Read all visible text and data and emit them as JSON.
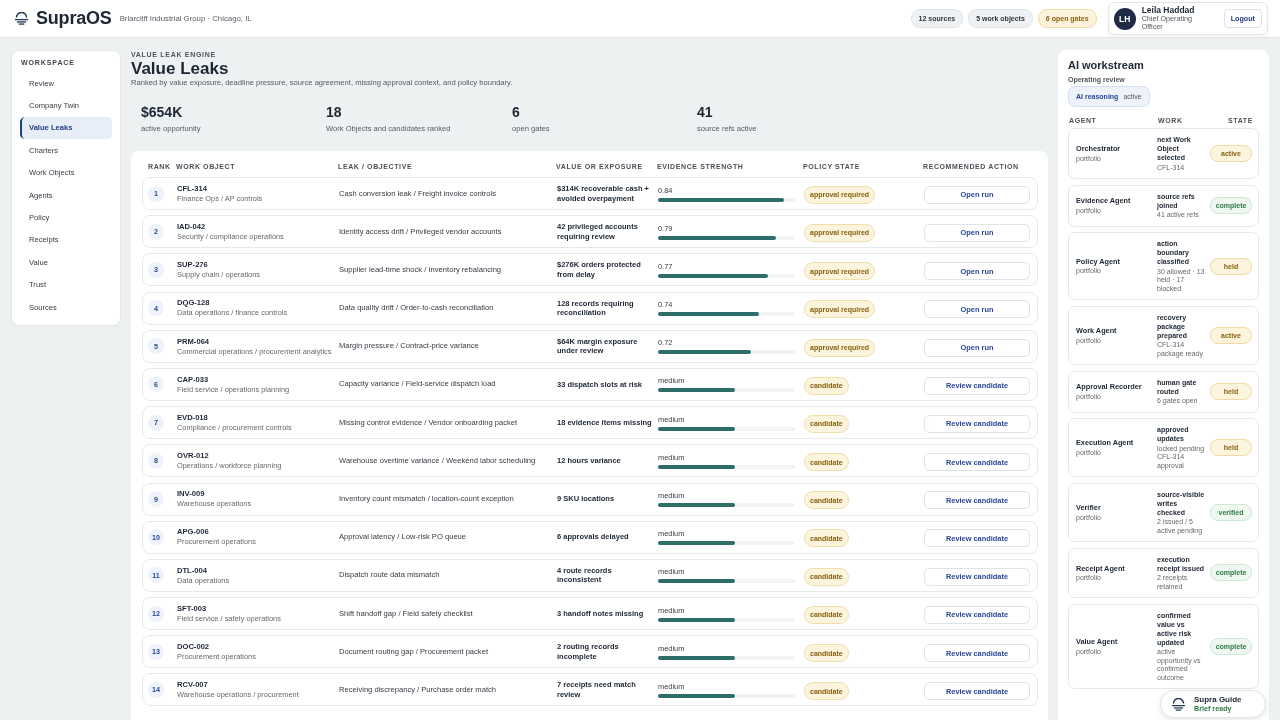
{
  "top_bar": {
    "brand": "SupraOS",
    "organization": "Briarcliff Industrial Group · Chicago, IL",
    "chips": [
      {
        "label": "12 sources",
        "kind": "neutral"
      },
      {
        "label": "5 work objects",
        "kind": "neutral"
      },
      {
        "label": "6 open gates",
        "kind": "warning"
      }
    ],
    "user": {
      "initials": "LH",
      "name": "Leila Haddad",
      "role": "Chief Operating Officer"
    },
    "logout": "Logout"
  },
  "sidebar": {
    "heading": "WORKSPACE",
    "items": [
      {
        "label": "Review",
        "selected": false
      },
      {
        "label": "Company Twin",
        "selected": false
      },
      {
        "label": "Value Leaks",
        "selected": true
      },
      {
        "label": "Charters",
        "selected": false
      },
      {
        "label": "Work Objects",
        "selected": false
      },
      {
        "label": "Agents",
        "selected": false
      },
      {
        "label": "Policy",
        "selected": false
      },
      {
        "label": "Receipts",
        "selected": false
      },
      {
        "label": "Value",
        "selected": false
      },
      {
        "label": "Trust",
        "selected": false
      },
      {
        "label": "Sources",
        "selected": false
      }
    ]
  },
  "page": {
    "kicker": "VALUE LEAK ENGINE",
    "title": "Value Leaks",
    "description": "Ranked by value exposure, deadline pressure, source agreement, missing approval context, and policy boundary."
  },
  "stats": [
    {
      "value": "$654K",
      "label": "active opportunity"
    },
    {
      "value": "18",
      "label": "Work Objects and candidates ranked"
    },
    {
      "value": "6",
      "label": "open gates"
    },
    {
      "value": "41",
      "label": "source refs active"
    }
  ],
  "table": {
    "columns": [
      "RANK",
      "WORK OBJECT",
      "LEAK / OBJECTIVE",
      "VALUE OR EXPOSURE",
      "EVIDENCE STRENGTH",
      "POLICY STATE",
      "RECOMMENDED ACTION"
    ],
    "rows": [
      {
        "rank": "1",
        "code": "CFL-314",
        "area": "Finance Ops / AP controls",
        "objective": "Cash conversion leak / Freight invoice controls",
        "value": "$314K recoverable cash + avoided overpayment",
        "evidence": "0.84",
        "level": 0.92,
        "policy": "approval required",
        "action": "Open run"
      },
      {
        "rank": "2",
        "code": "IAD-042",
        "area": "Security / compliance operations",
        "objective": "Identity access drift / Privileged vendor accounts",
        "value": "42 privileged accounts requiring review",
        "evidence": "0.79",
        "level": 0.86,
        "policy": "approval required",
        "action": "Open run"
      },
      {
        "rank": "3",
        "code": "SUP-276",
        "area": "Supply chain / operations",
        "objective": "Supplier lead-time shock / Inventory rebalancing",
        "value": "$276K orders protected from delay",
        "evidence": "0.77",
        "level": 0.8,
        "policy": "approval required",
        "action": "Open run"
      },
      {
        "rank": "4",
        "code": "DQG-128",
        "area": "Data operations / finance controls",
        "objective": "Data quality drift / Order-to-cash reconciliation",
        "value": "128 records requiring reconciliation",
        "evidence": "0.74",
        "level": 0.74,
        "policy": "approval required",
        "action": "Open run"
      },
      {
        "rank": "5",
        "code": "PRM-064",
        "area": "Commercial operations / procurement analytics",
        "objective": "Margin pressure / Contract-price variance",
        "value": "$64K margin exposure under review",
        "evidence": "0.72",
        "level": 0.68,
        "policy": "approval required",
        "action": "Open run"
      },
      {
        "rank": "6",
        "code": "CAP-033",
        "area": "Field service / operations planning",
        "objective": "Capacity variance / Field-service dispatch load",
        "value": "33 dispatch slots at risk",
        "evidence": "medium",
        "level": 0.56,
        "policy": "candidate",
        "action": "Review candidate"
      },
      {
        "rank": "7",
        "code": "EVD-018",
        "area": "Compliance / procurement controls",
        "objective": "Missing control evidence / Vendor onboarding packet",
        "value": "18 evidence items missing",
        "evidence": "medium",
        "level": 0.56,
        "policy": "candidate",
        "action": "Review candidate"
      },
      {
        "rank": "8",
        "code": "OVR-012",
        "area": "Operations / workforce planning",
        "objective": "Warehouse overtime variance / Weekend labor scheduling",
        "value": "12 hours variance",
        "evidence": "medium",
        "level": 0.56,
        "policy": "candidate",
        "action": "Review candidate"
      },
      {
        "rank": "9",
        "code": "INV-009",
        "area": "Warehouse operations",
        "objective": "Inventory count mismatch / location-count exception",
        "value": "9 SKU locations",
        "evidence": "medium",
        "level": 0.56,
        "policy": "candidate",
        "action": "Review candidate"
      },
      {
        "rank": "10",
        "code": "APG-006",
        "area": "Procurement operations",
        "objective": "Approval latency / Low-risk PO queue",
        "value": "6 approvals delayed",
        "evidence": "medium",
        "level": 0.56,
        "policy": "candidate",
        "action": "Review candidate"
      },
      {
        "rank": "11",
        "code": "DTL-004",
        "area": "Data operations",
        "objective": "Dispatch route data mismatch",
        "value": "4 route records inconsistent",
        "evidence": "medium",
        "level": 0.56,
        "policy": "candidate",
        "action": "Review candidate"
      },
      {
        "rank": "12",
        "code": "SFT-003",
        "area": "Field service / safety operations",
        "objective": "Shift handoff gap / Field safety checklist",
        "value": "3 handoff notes missing",
        "evidence": "medium",
        "level": 0.56,
        "policy": "candidate",
        "action": "Review candidate"
      },
      {
        "rank": "13",
        "code": "DOC-002",
        "area": "Procurement operations",
        "objective": "Document routing gap / Procurement packet",
        "value": "2 routing records incomplete",
        "evidence": "medium",
        "level": 0.56,
        "policy": "candidate",
        "action": "Review candidate"
      },
      {
        "rank": "14",
        "code": "RCV-007",
        "area": "Warehouse operations / procurement",
        "objective": "Receiving discrepancy / Purchase order match",
        "value": "7 receipts need match review",
        "evidence": "medium",
        "level": 0.56,
        "policy": "candidate",
        "action": "Review candidate"
      }
    ]
  },
  "ai_panel": {
    "title": "AI workstream",
    "subtitle": "Operating review",
    "mode": {
      "label": "AI reasoning",
      "status": "active"
    },
    "columns": [
      "AGENT",
      "WORK",
      "STATE"
    ],
    "agents": [
      {
        "name": "Orchestrator",
        "scope": "portfolio",
        "work": "next Work Object selected",
        "detail": "CFL-314",
        "state": "active",
        "kind": "progress"
      },
      {
        "name": "Evidence Agent",
        "scope": "portfolio",
        "work": "source refs joined",
        "detail": "41 active refs",
        "state": "complete",
        "kind": "done"
      },
      {
        "name": "Policy Agent",
        "scope": "portfolio",
        "work": "action boundary classified",
        "detail": "30 allowed · 13 held · 17 blocked",
        "state": "held",
        "kind": "progress"
      },
      {
        "name": "Work Agent",
        "scope": "portfolio",
        "work": "recovery package prepared",
        "detail": "CFL-314 package ready",
        "state": "active",
        "kind": "progress"
      },
      {
        "name": "Approval Recorder",
        "scope": "portfolio",
        "work": "human gate routed",
        "detail": "6 gates open",
        "state": "held",
        "kind": "progress"
      },
      {
        "name": "Execution Agent",
        "scope": "portfolio",
        "work": "approved updates",
        "detail": "locked pending CFL-314 approval",
        "state": "held",
        "kind": "progress"
      },
      {
        "name": "Verifier",
        "scope": "portfolio",
        "work": "source-visible writes checked",
        "detail": "2 issued / 5 active pending",
        "state": "verified",
        "kind": "done"
      },
      {
        "name": "Receipt Agent",
        "scope": "portfolio",
        "work": "execution receipt issued",
        "detail": "2 receipts retained",
        "state": "complete",
        "kind": "done"
      },
      {
        "name": "Value Agent",
        "scope": "portfolio",
        "work": "confirmed value vs active risk updated",
        "detail": "active opportunity vs confirmed outcome",
        "state": "complete",
        "kind": "done"
      }
    ]
  },
  "guide": {
    "title": "Supra Guide",
    "status": "Brief ready"
  }
}
